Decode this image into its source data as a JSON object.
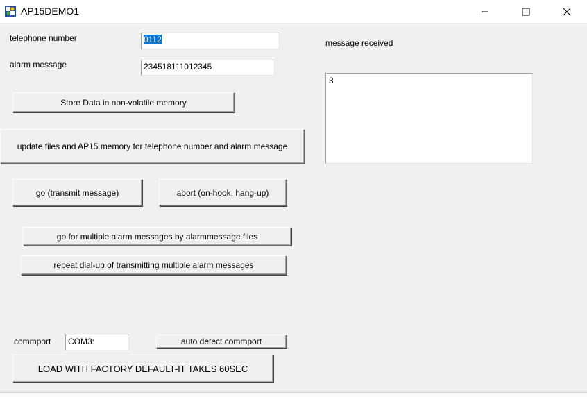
{
  "window": {
    "title": "AP15DEMO1",
    "minimize_glyph": "—",
    "maximize_glyph": "☐",
    "close_glyph": "✕"
  },
  "form": {
    "telephone_label": "telephone number",
    "telephone_value": "0112",
    "alarm_label": "alarm message",
    "alarm_value": "234518111012345",
    "message_received_label": "message received",
    "message_received_value": "3",
    "commport_label": "commport",
    "commport_value": "COM3:"
  },
  "buttons": {
    "store": "Store Data in non-volatile memory",
    "update": "update files and AP15 memory for telephone number and alarm message",
    "go": "go (transmit message)",
    "abort": "abort (on-hook, hang-up)",
    "go_multiple": "go for multiple alarm messages by alarmmessage files",
    "repeat": "repeat dial-up of transmitting multiple alarm messages",
    "auto_detect": "auto detect commport",
    "load_factory": "LOAD WITH FACTORY DEFAULT-IT TAKES 60SEC"
  }
}
